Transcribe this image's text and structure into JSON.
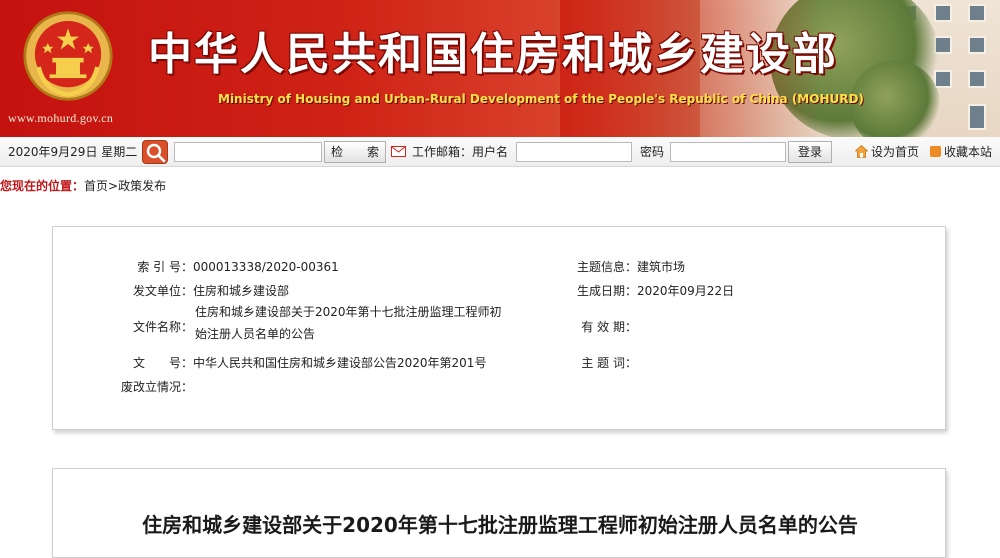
{
  "header": {
    "site_url": "www.mohurd.gov.cn",
    "title": "中华人民共和国住房和城乡建设部",
    "subtitle": "Ministry of Housing and Urban-Rural Development of the People's Republic of China (MOHURD)"
  },
  "toolbar": {
    "date": "2020年9月29日  星期二",
    "search_value": "",
    "search_button": "检　　索",
    "mail_label": "工作邮箱：用户名",
    "username_value": "",
    "password_label": "密码",
    "password_value": "",
    "login_button": "登录",
    "set_home": "设为首页",
    "bookmark": "收藏本站"
  },
  "breadcrumb": {
    "prefix": "您现在的位置：",
    "home": "首页",
    "separator": ">",
    "current": "政策发布"
  },
  "info": {
    "index_label": "索 引 号：",
    "index_value": "000013338/2020-00361",
    "topic_label": "主题信息：",
    "topic_value": "建筑市场",
    "issuer_label": "发文单位：",
    "issuer_value": "住房和城乡建设部",
    "date_label": "生成日期：",
    "date_value": "2020年09月22日",
    "filename_label": "文件名称：",
    "filename_value_line1": "住房和城乡建设部关于2020年第十七批注册监理工程师初",
    "filename_value_line2": "始注册人员名单的公告",
    "validity_label": "有 效 期：",
    "validity_value": "",
    "docno_label": "文　　号：",
    "docno_value": "中华人民共和国住房和城乡建设部公告2020年第201号",
    "keywords_label": "主 题 词：",
    "keywords_value": "",
    "status_label": "废改立情况：",
    "status_value": ""
  },
  "article": {
    "title": "住房和城乡建设部关于2020年第十七批注册监理工程师初始注册人员名单的公告"
  },
  "colors": {
    "banner_red": "#cf2316",
    "title_yellow": "#ffe24a",
    "breadcrumb_red": "#c0171a"
  }
}
